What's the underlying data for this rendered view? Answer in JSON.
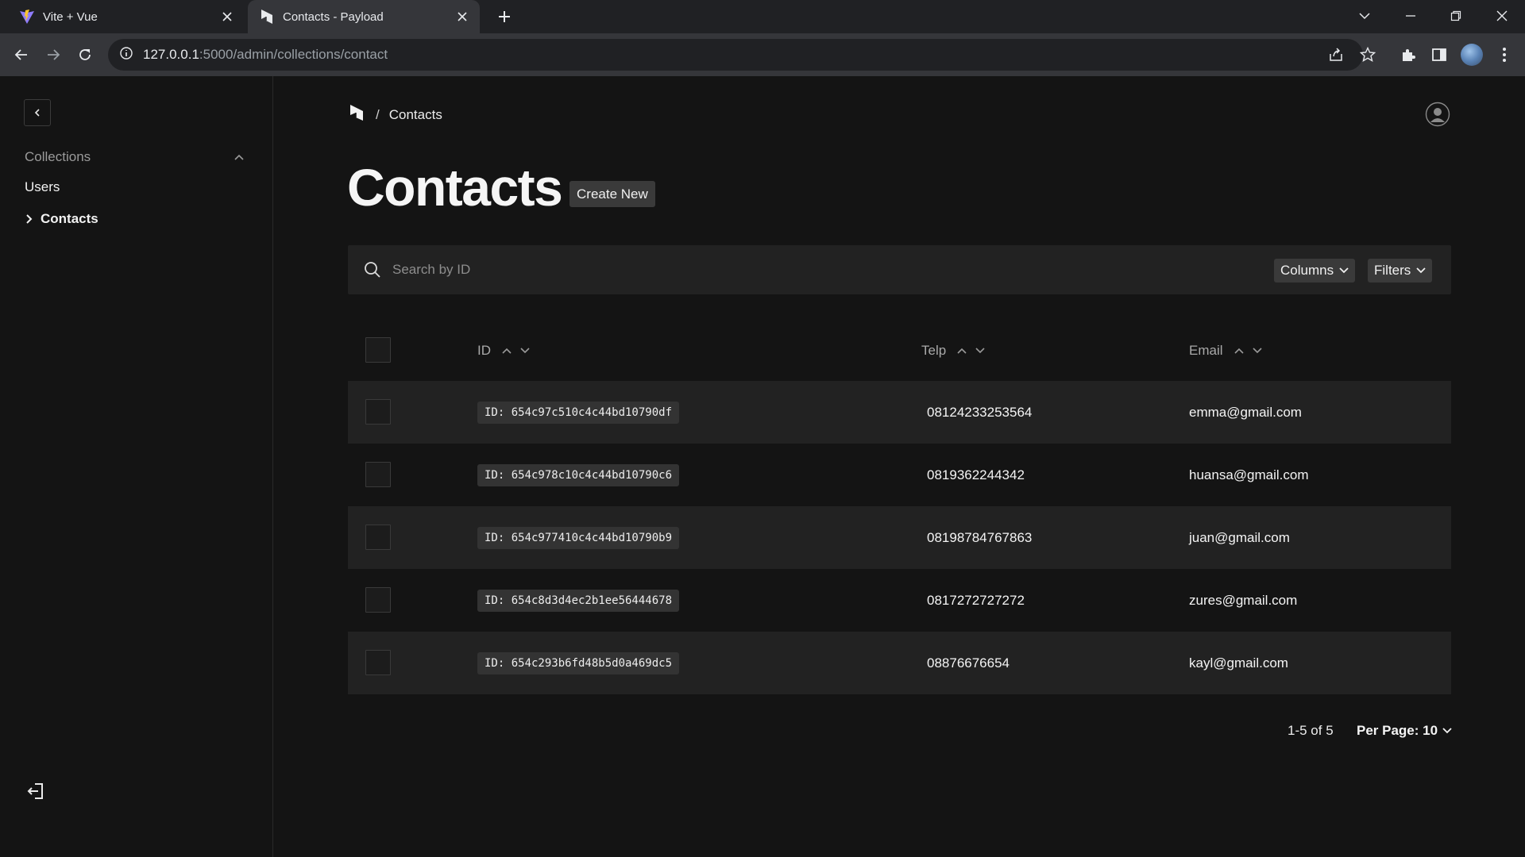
{
  "browser": {
    "tabs": [
      {
        "title": "Vite + Vue",
        "icon": "vite-logo-icon",
        "active": false
      },
      {
        "title": "Contacts - Payload",
        "icon": "payload-logo-icon",
        "active": true
      }
    ],
    "url_host": "127.0.0.1",
    "url_path": ":5000/admin/collections/contact"
  },
  "sidebar": {
    "group_label": "Collections",
    "items": [
      {
        "label": "Users",
        "active": false
      },
      {
        "label": "Contacts",
        "active": true
      }
    ]
  },
  "breadcrumb": {
    "current": "Contacts"
  },
  "header": {
    "title": "Contacts",
    "create_label": "Create New"
  },
  "search": {
    "placeholder": "Search by ID",
    "columns_label": "Columns",
    "filters_label": "Filters"
  },
  "table": {
    "columns": [
      "ID",
      "Telp",
      "Email"
    ],
    "rows": [
      {
        "id": "ID: 654c97c510c4c44bd10790df",
        "telp": "08124233253564",
        "email": "emma@gmail.com"
      },
      {
        "id": "ID: 654c978c10c4c44bd10790c6",
        "telp": "0819362244342",
        "email": "huansa@gmail.com"
      },
      {
        "id": "ID: 654c977410c4c44bd10790b9",
        "telp": "08198784767863",
        "email": "juan@gmail.com"
      },
      {
        "id": "ID: 654c8d3d4ec2b1ee56444678",
        "telp": "0817272727272",
        "email": "zures@gmail.com"
      },
      {
        "id": "ID: 654c293b6fd48b5d0a469dc5",
        "telp": "08876676654",
        "email": "kayl@gmail.com"
      }
    ]
  },
  "pagination": {
    "info": "1-5 of 5",
    "per_page": "Per Page: 10"
  },
  "colors": {
    "background": "#141414",
    "panel": "#222222",
    "button": "#3a3a3a",
    "chrome": "#35363a"
  }
}
